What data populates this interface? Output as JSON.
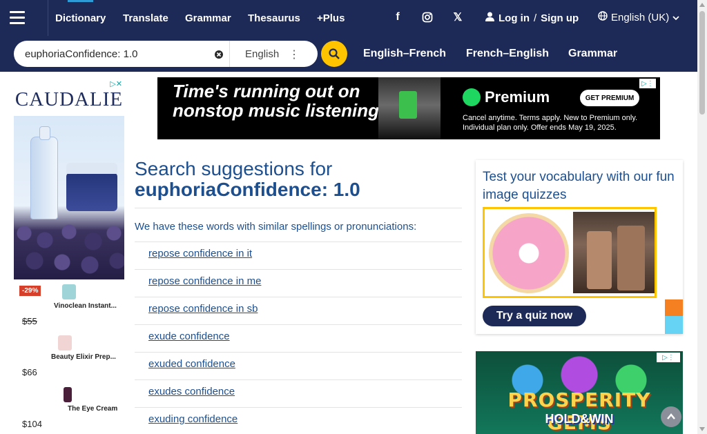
{
  "header": {
    "nav": [
      {
        "label": "Dictionary"
      },
      {
        "label": "Translate"
      },
      {
        "label": "Grammar"
      },
      {
        "label": "Thesaurus"
      },
      {
        "label": "+Plus"
      }
    ],
    "social": {
      "facebook": "f",
      "x": "𝕏"
    },
    "auth": {
      "login": "Log in",
      "separator": "/",
      "signup": "Sign up"
    },
    "language": "English (UK)"
  },
  "search": {
    "value": "euphoriaConfidence: 1.0",
    "language": "English",
    "tabs": [
      "English–French",
      "French–English",
      "Grammar"
    ]
  },
  "left_ad": {
    "brand": "CAUDALIE",
    "products": [
      {
        "badge": "-29%",
        "name": "Vinoclean Instant...",
        "price": "$55",
        "strike": true
      },
      {
        "badge": "",
        "name": "Beauty Elixir Prep...",
        "price": "$66",
        "strike": false
      },
      {
        "badge": "",
        "name": "The Eye Cream",
        "price": "$104",
        "strike": false
      }
    ]
  },
  "banner_ad": {
    "headline": "Time's running out on nonstop music listening.",
    "brand": "Premium",
    "cta": "GET PREMIUM",
    "fine_print": "Cancel anytime. Terms apply. New to Premium only. Individual plan only. Offer ends May 19, 2025."
  },
  "main": {
    "heading_prefix": "Search suggestions for",
    "heading_term": "euphoriaConfidence: 1.0",
    "intro": "We have these words with similar spellings or pronunciations:",
    "suggestions": [
      "repose confidence in it",
      "repose confidence in me",
      "repose confidence in sb",
      "exude confidence",
      "exuded confidence",
      "exudes confidence",
      "exuding confidence"
    ]
  },
  "quiz": {
    "title": "Test your vocabulary with our fun image quizzes",
    "button": "Try a quiz now"
  },
  "game_ad": {
    "title": "PROSPERITY GEMS",
    "subtitle": "HOLD&WIN"
  }
}
